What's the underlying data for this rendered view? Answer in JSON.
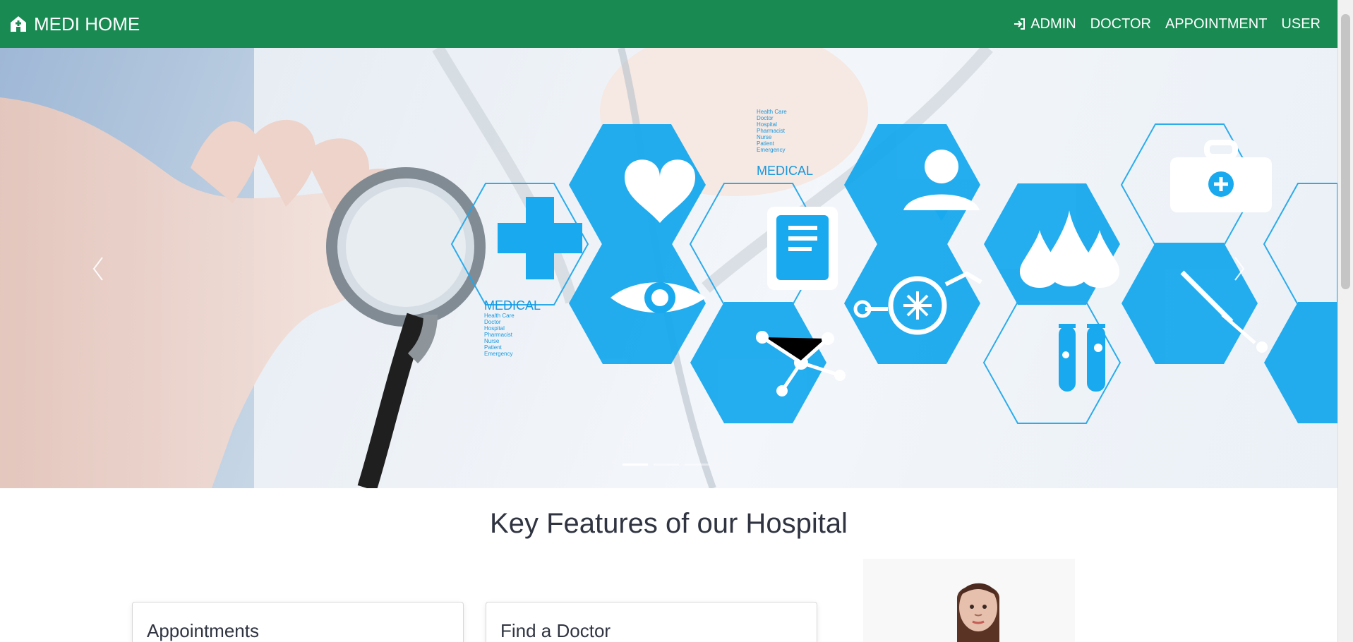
{
  "navbar": {
    "brand": "MEDI HOME",
    "links": [
      {
        "label": "ADMIN",
        "icon": "sign-in-icon"
      },
      {
        "label": "DOCTOR"
      },
      {
        "label": "APPOINTMENT"
      },
      {
        "label": "USER"
      }
    ]
  },
  "hero": {
    "medical_text_top": "MEDICAL",
    "medical_text_left": "MEDICAL",
    "small_text_lines": [
      "Health Care",
      "Doctor",
      "Hospital",
      "Pharmacist",
      "Nurse",
      "Patient",
      "Emergency"
    ]
  },
  "carousel": {
    "prev_icon": "chevron-left-icon",
    "next_icon": "chevron-right-icon",
    "active_indicator": 1,
    "indicators": 3
  },
  "features": {
    "title": "Key Features of our Hospital",
    "cards": [
      {
        "title": "Appointments"
      },
      {
        "title": "Find a Doctor"
      }
    ]
  },
  "colors": {
    "navbar": "#1a8a53",
    "hero_blue": "#18a9ee",
    "text_dark": "#2f3440"
  }
}
